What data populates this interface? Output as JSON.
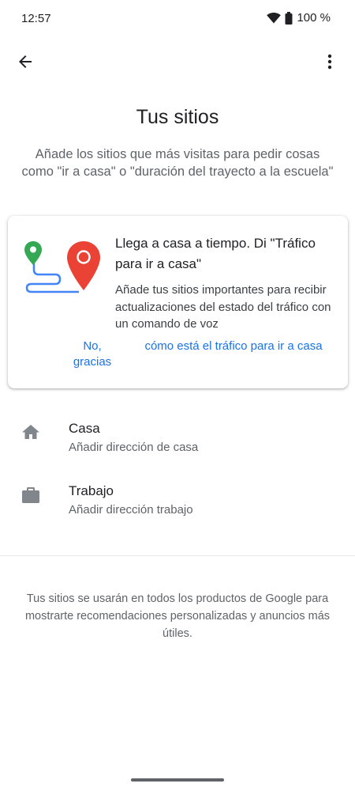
{
  "status_bar": {
    "time": "12:57",
    "battery": "100 %",
    "icons": [
      "wifi-icon",
      "battery-icon"
    ]
  },
  "app_bar": {
    "back_icon": "arrow-back-icon",
    "more_icon": "more-vert-icon"
  },
  "page": {
    "title": "Tus sitios",
    "subtitle": "Añade los sitios que más visitas para pedir cosas como \"ir a casa\" o \"duración del trayecto a la escuela\""
  },
  "card": {
    "illustration": "route-map-pins-icon",
    "title": "Llega a casa a tiempo. Di \"Tráfico para ir a casa\"",
    "body": "Añade tus sitios importantes para recibir actualizaciones del estado del tráfico con un comando de voz",
    "action_dismiss": "No, gracias",
    "action_accept": "cómo está el tráfico para ir a casa"
  },
  "places": [
    {
      "icon": "home-icon",
      "name": "Casa",
      "subtitle": "Añadir dirección de casa"
    },
    {
      "icon": "briefcase-icon",
      "name": "Trabajo",
      "subtitle": "Añadir dirección trabajo"
    }
  ],
  "footer": {
    "note": "Tus sitios se usarán en todos los productos de Google para mostrarte recomendaciones personalizadas y anuncios más útiles."
  },
  "colors": {
    "accent": "#1a73e8",
    "text_primary": "#202124",
    "text_secondary": "#5f6368",
    "icon_gray": "#80868b",
    "pin_red": "#ea4335",
    "pin_green": "#34a853",
    "route_blue": "#4285f4"
  }
}
